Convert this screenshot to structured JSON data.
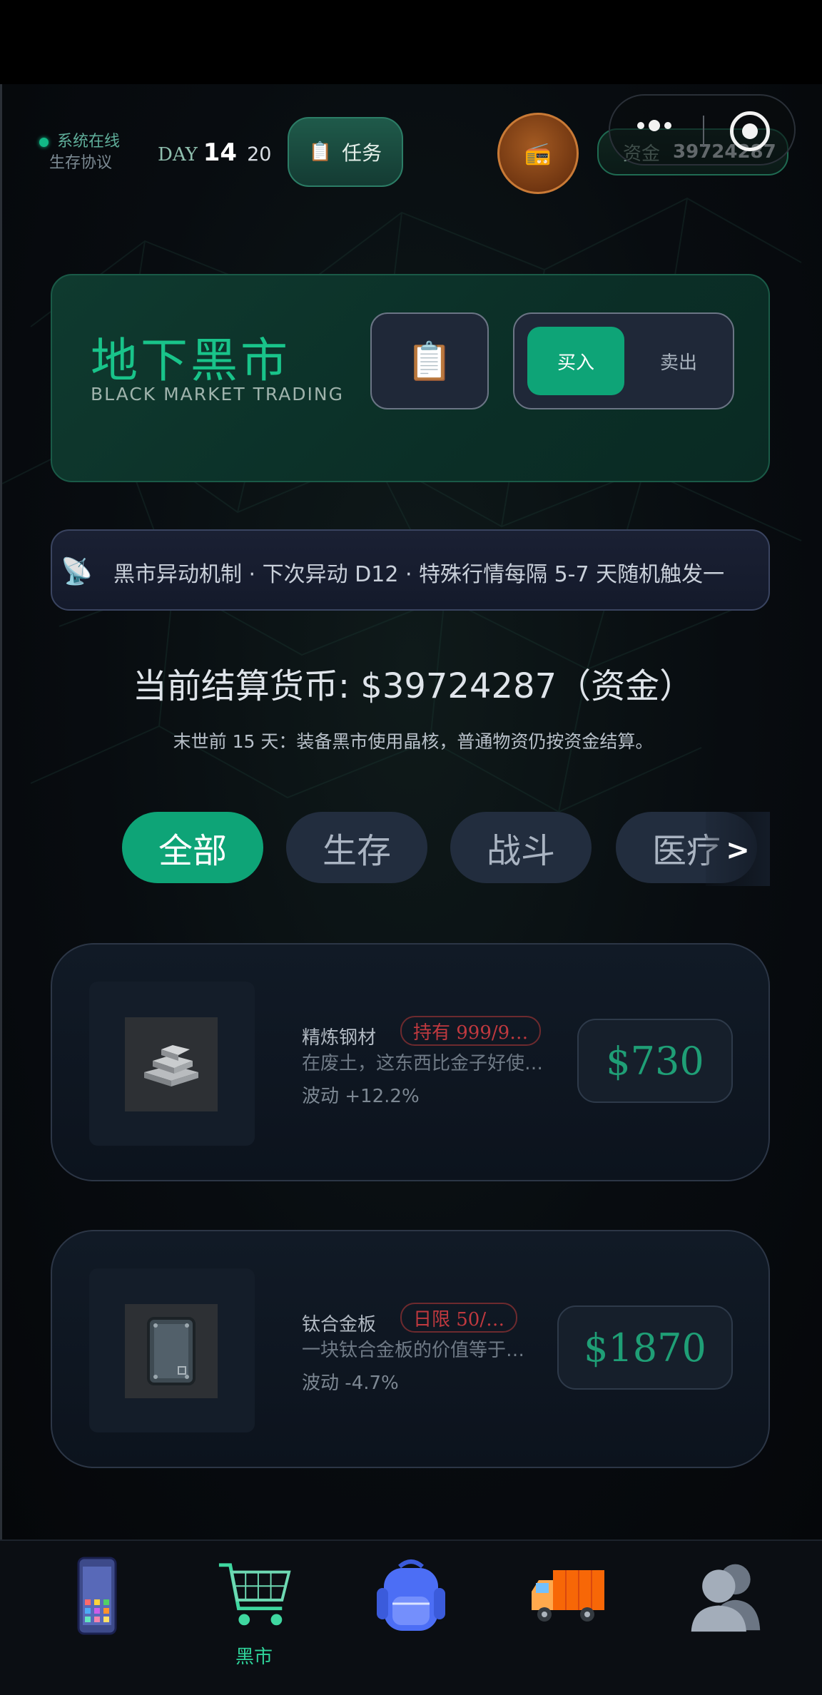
{
  "status": {
    "line1": "系统在线",
    "line2": "生存协议"
  },
  "day": {
    "label": "DAY",
    "value": "14",
    "sub": "20"
  },
  "task_button": {
    "label": "任务",
    "icon": "clipboard-icon"
  },
  "radio_button": {
    "icon": "radio-icon"
  },
  "fund": {
    "label": "资金",
    "value": "39724287"
  },
  "header": {
    "title": "地下黑市",
    "subtitle": "BLACK MARKET TRADING",
    "buy": "买入",
    "sell": "卖出"
  },
  "ticker": {
    "text": "黑市异动机制 · 下次异动 D12 · 特殊行情每隔 5-7 天随机触发一"
  },
  "currency_line": "当前结算货币: $39724287（资金）",
  "note": "末世前 15 天：装备黑市使用晶核，普通物资仍按资金结算。",
  "tabs": [
    {
      "label": "全部",
      "active": true
    },
    {
      "label": "生存",
      "active": false
    },
    {
      "label": "战斗",
      "active": false
    },
    {
      "label": "医疗",
      "active": false
    }
  ],
  "tabs_more": ">",
  "items": [
    {
      "name": "精炼钢材",
      "badge": "持有 999/9…",
      "desc": "在废土，这东西比金子好使…",
      "change": "波动 +12.2%",
      "price": "$730"
    },
    {
      "name": "钛合金板",
      "badge": "日限 50/…",
      "desc": "一块钛合金板的价值等于…",
      "change": "波动 -4.7%",
      "price": "$1870"
    }
  ],
  "bottom_nav": [
    {
      "icon": "phone-icon",
      "label": ""
    },
    {
      "icon": "cart-icon",
      "label": "黑市"
    },
    {
      "icon": "backpack-icon",
      "label": ""
    },
    {
      "icon": "truck-icon",
      "label": ""
    },
    {
      "icon": "users-icon",
      "label": ""
    }
  ]
}
